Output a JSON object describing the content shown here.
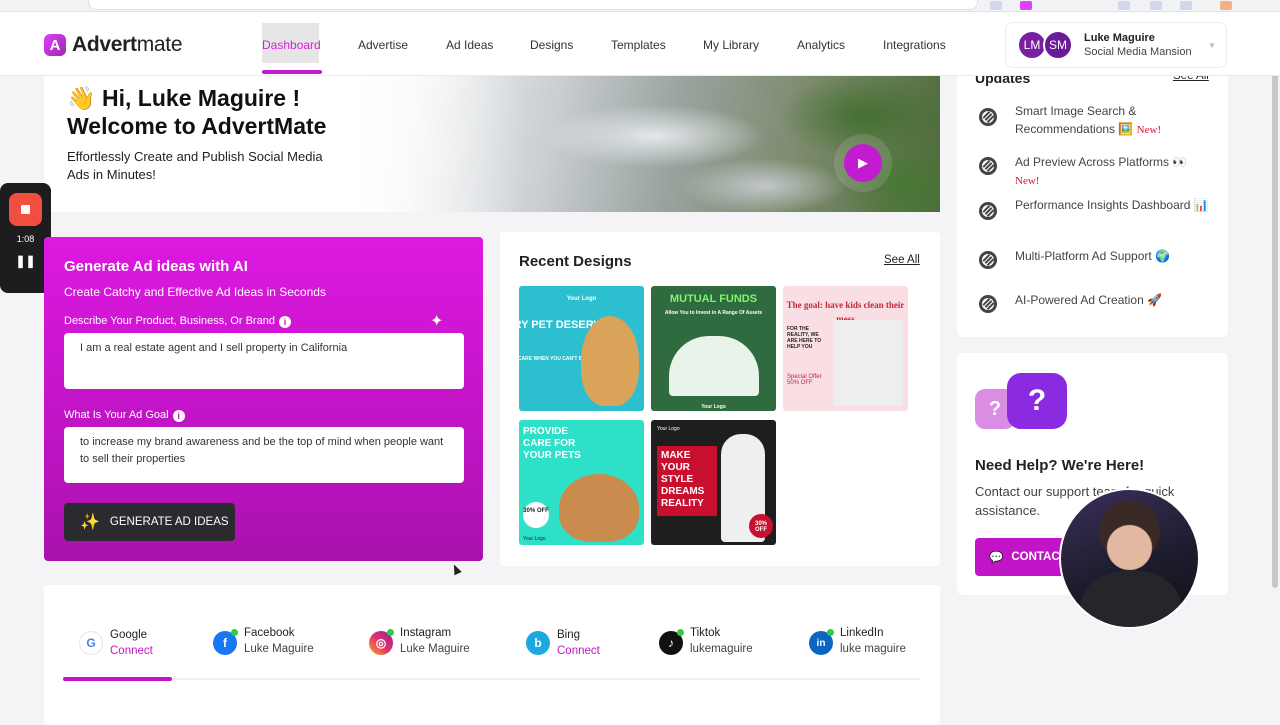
{
  "nav": {
    "logo_bold": "Advert",
    "logo_thin": "mate",
    "logo_mark": "A",
    "items": [
      "Dashboard",
      "Advertise",
      "Ad Ideas",
      "Designs",
      "Templates",
      "My Library",
      "Analytics",
      "Integrations"
    ],
    "active": "Dashboard"
  },
  "user": {
    "name": "Luke Maguire",
    "org": "Social Media Mansion",
    "initials_1": "LM",
    "initials_2": "SM"
  },
  "hero": {
    "greeting": "👋 Hi, Luke Maguire !",
    "welcome": "Welcome to AdvertMate",
    "subtitle": "Effortlessly Create and Publish Social Media Ads in Minutes!"
  },
  "recorder": {
    "time": "1:08"
  },
  "ai": {
    "title": "Generate Ad ideas with AI",
    "subtitle": "Create Catchy and Effective Ad Ideas in Seconds",
    "product_label": "Describe Your Product, Business, Or Brand",
    "product_value": "I am a real estate agent and I sell property in California",
    "goal_label": "What Is Your Ad Goal",
    "goal_value": "to increase my brand awareness and be the top of mind when people want to sell their properties",
    "button": "GENERATE AD IDEAS"
  },
  "recent": {
    "title": "Recent Designs",
    "see_all": "See All",
    "designs": [
      {
        "title": "EVERY PET DESERVES",
        "sub": "TRUE CARE WHEN YOU CAN'T BE THERE",
        "logo": "Your Logo"
      },
      {
        "title": "MUTUAL FUNDS",
        "sub": "Allow You to Invest in A Range Of Assets",
        "logo": "Your Logo"
      },
      {
        "title": "The goal: have kids clean their mess",
        "sub": "FOR THE REALITY, WE ARE HERE TO HELP YOU",
        "badge": "Special Offer 50% OFF"
      },
      {
        "title": "PROVIDE CARE FOR YOUR PETS",
        "badge": "30% OFF",
        "logo": "Your Logo"
      },
      {
        "title": "MAKE YOUR STYLE DREAMS REALITY",
        "badge": "30% OFF",
        "logo": "Your Logo"
      }
    ]
  },
  "updates": {
    "title": "Updates",
    "see_all": "See All",
    "new_label": "New!",
    "items": [
      {
        "text": "Smart Image Search & Recommendations 🖼️",
        "is_new": true
      },
      {
        "text": "Ad Preview Across Platforms 👀",
        "is_new": true
      },
      {
        "text": "Performance Insights Dashboard 📊",
        "is_new": false
      },
      {
        "text": "Multi-Platform Ad Support 🌍",
        "is_new": false
      },
      {
        "text": "AI-Powered Ad Creation 🚀",
        "is_new": false
      }
    ]
  },
  "help": {
    "title": "Need Help? We're Here!",
    "text": "Contact our support team for quick assistance.",
    "button": "CONTACT"
  },
  "social": [
    {
      "name": "Google",
      "status": "Connect",
      "connected": false,
      "color": "#ffffff",
      "glyph": "G"
    },
    {
      "name": "Facebook",
      "status": "Luke Maguire",
      "connected": true,
      "color": "#1877f2",
      "glyph": "f"
    },
    {
      "name": "Instagram",
      "status": "Luke Maguire",
      "connected": true,
      "color": "#e1306c",
      "glyph": "◎"
    },
    {
      "name": "Bing",
      "status": "Connect",
      "connected": false,
      "color": "#1ba9e0",
      "glyph": "b"
    },
    {
      "name": "Tiktok",
      "status": "lukemaguire",
      "connected": true,
      "color": "#111111",
      "glyph": "♪"
    },
    {
      "name": "LinkedIn",
      "status": "luke maguire",
      "connected": true,
      "color": "#0a66c2",
      "glyph": "in"
    }
  ],
  "colors": {
    "accent": "#c214c7",
    "accent_light": "#dd19e0",
    "dark_button": "#2b2b2f",
    "new_red": "#e0102a"
  }
}
